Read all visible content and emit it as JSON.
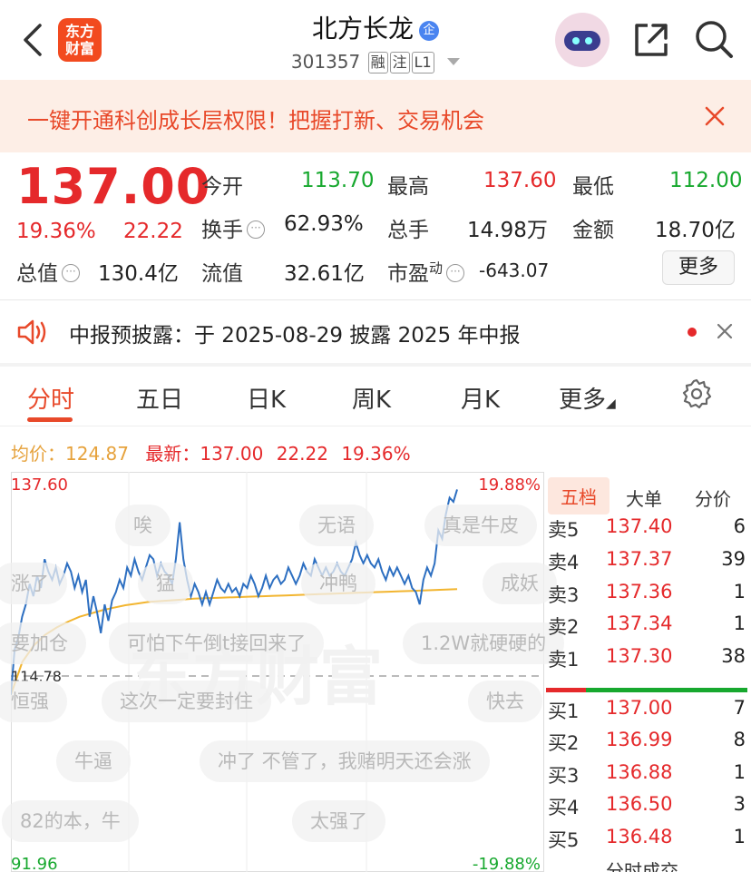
{
  "header": {
    "title": "北方长龙",
    "qi_badge": "企",
    "brand": "东方财富",
    "code": "301357",
    "tags": [
      "融",
      "注",
      "L1"
    ]
  },
  "banner": {
    "text": "一键开通科创成长层权限！把握打新、交易机会"
  },
  "quote": {
    "price": "137.00",
    "change_pct": "19.36%",
    "change": "22.22",
    "open_label": "今开",
    "open": "113.70",
    "high_label": "最高",
    "high": "137.60",
    "low_label": "最低",
    "low": "112.00",
    "turnover_label": "换手",
    "turnover": "62.93%",
    "volume_label": "总手",
    "volume": "14.98万",
    "amount_label": "金额",
    "amount": "18.70亿",
    "mktcap_label": "总值",
    "mktcap": "130.4亿",
    "float_label": "流值",
    "float": "32.61亿",
    "pe_label": "市盈",
    "pe_sup": "动",
    "pe": "-643.07",
    "more_label": "更多"
  },
  "notice": {
    "text": "中报预披露：于 2025-08-29 披露 2025 年中报"
  },
  "tabs": [
    "分时",
    "五日",
    "日K",
    "周K",
    "月K",
    "更多"
  ],
  "chart_header": {
    "avg_label": "均价：",
    "avg": "124.87",
    "latest_label": "最新：",
    "latest": "137.00",
    "latest_change": "22.22",
    "latest_pct": "19.36%"
  },
  "chart_data": {
    "type": "line",
    "title": "",
    "y_top": "137.60",
    "y_top_pct": "19.88%",
    "y_mid": "114.78",
    "y_bottom": "91.96",
    "y_bottom_pct": "-19.88%",
    "ylim": [
      91.96,
      137.6
    ],
    "series": [
      {
        "name": "price",
        "values": [
          112.0,
          117.5,
          119.0,
          121.5,
          123.0,
          125.5,
          124.0,
          126.5,
          125.0,
          128.5,
          127.0,
          126.0,
          127.5,
          125.5,
          126.5,
          128.0,
          127.0,
          125.0,
          126.5,
          124.5,
          126.0,
          121.5,
          124.0,
          122.0,
          119.5,
          123.0,
          121.0,
          123.5,
          124.5,
          126.0,
          125.0,
          127.5,
          126.5,
          128.5,
          127.0,
          126.0,
          127.5,
          129.0,
          128.5,
          126.5,
          128.0,
          127.0,
          126.5,
          125.5,
          128.5,
          133.0,
          128.5,
          126.0,
          124.0,
          125.5,
          124.5,
          123.0,
          124.5,
          123.0,
          124.5,
          126.0,
          125.0,
          124.5,
          125.5,
          124.5,
          125.0,
          124.0,
          125.5,
          125.0,
          126.5,
          125.5,
          124.0,
          125.0,
          126.5,
          125.0,
          126.0,
          126.5,
          125.5,
          126.0,
          127.5,
          126.5,
          125.5,
          126.5,
          128.0,
          127.0,
          126.5,
          128.5,
          127.5,
          126.5,
          127.5,
          126.5,
          127.0,
          128.0,
          127.0,
          126.5,
          127.5,
          128.5,
          130.5,
          129.0,
          128.0,
          129.0,
          128.0,
          127.5,
          128.5,
          127.0,
          126.0,
          127.5,
          126.5,
          127.5,
          126.5,
          125.5,
          126.5,
          125.0,
          124.5,
          123.0,
          126.0,
          127.5,
          126.5,
          128.0,
          132.0,
          131.0,
          134.0,
          136.0,
          135.5,
          137.0
        ]
      },
      {
        "name": "avg",
        "values": [
          112.0,
          116.0,
          118.0,
          119.3,
          120.2,
          120.9,
          121.5,
          121.9,
          122.3,
          122.6,
          122.9,
          123.1,
          123.3,
          123.4,
          123.5,
          123.6,
          123.7,
          123.75,
          123.8,
          123.85,
          123.9,
          123.95,
          124.0,
          124.05,
          124.1,
          124.15,
          124.2,
          124.25,
          124.3,
          124.35,
          124.4,
          124.45,
          124.5,
          124.55,
          124.6,
          124.65,
          124.7,
          124.75,
          124.8,
          124.87
        ]
      }
    ]
  },
  "danmu": [
    "唉",
    "无语",
    "真是牛皮",
    "涨了",
    "猛",
    "冲鸭",
    "成妖",
    "要加仓",
    "可怕下午倒t接回来了",
    "1.2W就硬硬的",
    "恒强",
    "这次一定要封住",
    "快去",
    "牛逼",
    "冲了 不管了，我赌明天还会涨",
    "82的本，牛",
    "太强了"
  ],
  "watermark": "东方财富",
  "order_book": {
    "tabs": [
      "五档",
      "大单",
      "分价"
    ],
    "asks": [
      {
        "label": "卖5",
        "price": "137.40",
        "vol": "6"
      },
      {
        "label": "卖4",
        "price": "137.37",
        "vol": "39"
      },
      {
        "label": "卖3",
        "price": "137.36",
        "vol": "1"
      },
      {
        "label": "卖2",
        "price": "137.34",
        "vol": "1"
      },
      {
        "label": "卖1",
        "price": "137.30",
        "vol": "38"
      }
    ],
    "bids": [
      {
        "label": "买1",
        "price": "137.00",
        "vol": "7"
      },
      {
        "label": "买2",
        "price": "136.99",
        "vol": "8"
      },
      {
        "label": "买3",
        "price": "136.88",
        "vol": "1"
      },
      {
        "label": "买4",
        "price": "136.50",
        "vol": "3"
      },
      {
        "label": "买5",
        "price": "136.48",
        "vol": "1"
      }
    ],
    "footer_partial": "分时成交"
  },
  "colors": {
    "up": "#e5292b",
    "down": "#17a82e",
    "accent": "#e8492a",
    "price_line": "#2d6fc1",
    "avg_line": "#f2b530"
  }
}
